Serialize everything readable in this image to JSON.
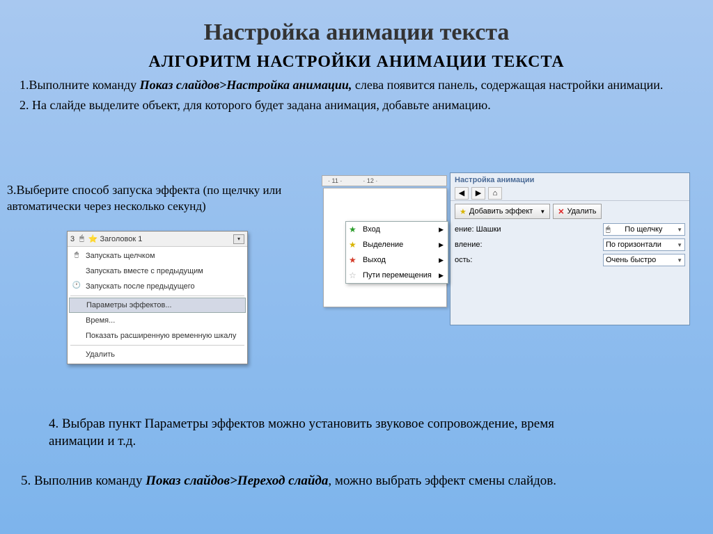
{
  "title": "Настройка анимации текста",
  "algo_title": "АЛГОРИТМ НАСТРОЙКИ АНИМАЦИИ ТЕКСТА",
  "step1": {
    "pre": "1.Выполните команду ",
    "bold": "Показ слайдов>Настройка анимации, ",
    "post": "слева появится панель, содержащая настройки анимации."
  },
  "step2": "2. На слайде выделите объект, для которого будет задана анимация, добавьте анимацию.",
  "step3": {
    "line1": "3.Выберите способ запуска эффекта ",
    "sub": "(по щелчку или автоматически через несколько секунд)"
  },
  "step4": "4. Выбрав пункт Параметры эффектов можно установить звуковое сопровождение,  время анимации и т.д.",
  "step5": {
    "pre": "5. Выполнив команду ",
    "bold": "Показ слайдов>Переход слайда",
    "post": ", можно выбрать эффект смены слайдов."
  },
  "shot1": {
    "num": "3",
    "header_icon": "⏵",
    "header_star": "⭐",
    "title": "Заголовок 1",
    "items": [
      "Запускать щелчком",
      "Запускать вместе с предыдущим",
      "Запускать после предыдущего"
    ],
    "selected": "Параметры эффектов...",
    "items2": [
      "Время...",
      "Показать расширенную временную шкалу",
      "Удалить"
    ]
  },
  "shot2": {
    "ruler1": "11",
    "ruler2": "12",
    "pane_title": "Настройка анимации",
    "nav_back": "◀",
    "nav_fwd": "▶",
    "nav_home": "⌂",
    "add_effect_star": "★",
    "add_effect": "Добавить эффект",
    "remove_x": "✕",
    "remove": "Удалить",
    "row_label1": "ение: Шашки",
    "row_label2": "вление:",
    "row_label3": "ость:",
    "val1": "По щелчку",
    "val2": "По горизонтали",
    "val3": "Очень быстро",
    "flyout": {
      "i1": "Вход",
      "i2": "Выделение",
      "i3": "Выход",
      "i4": "Пути перемещения"
    }
  }
}
